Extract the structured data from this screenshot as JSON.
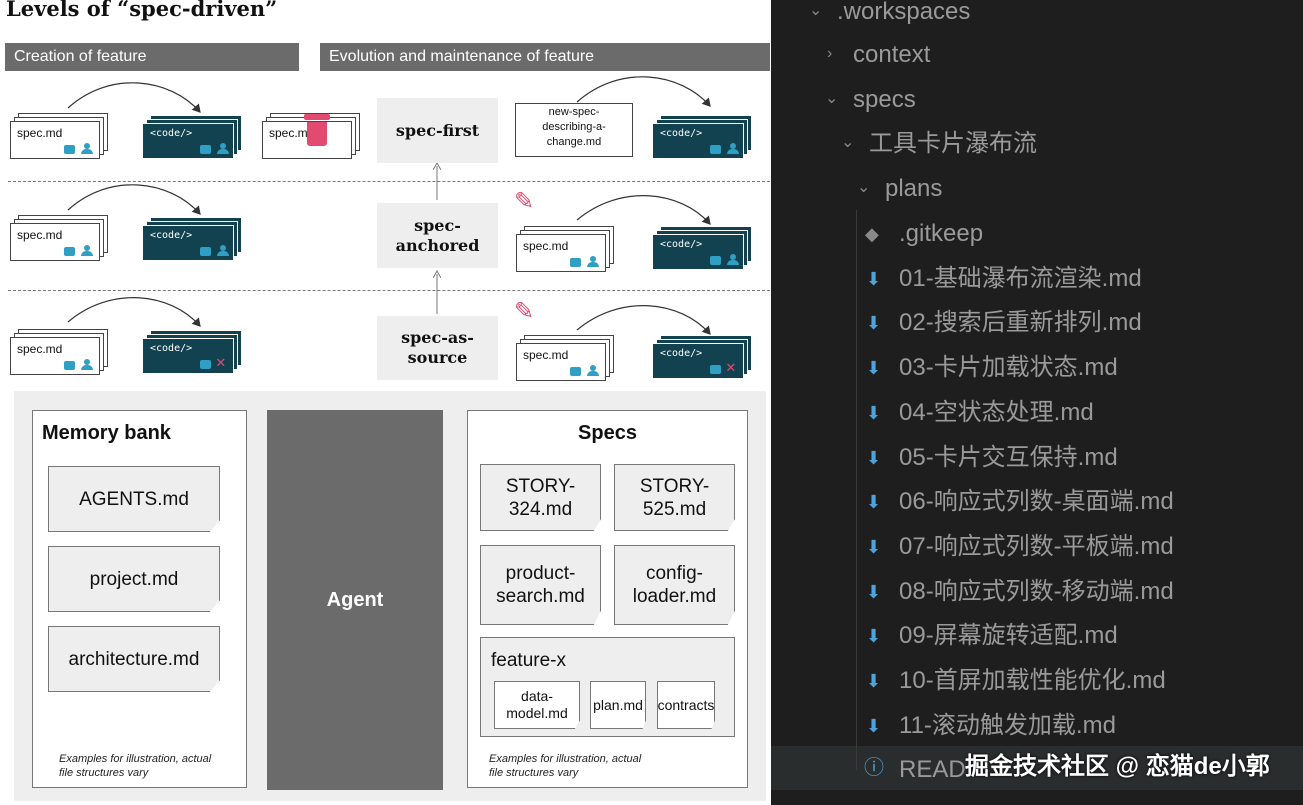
{
  "diagram": {
    "title": "Levels of “spec-driven”",
    "bar_creation": "Creation of feature",
    "bar_evolution": "Evolution and maintenance of feature",
    "levels": [
      "spec-first",
      "spec-anchored",
      "spec-as-source"
    ],
    "spec_file": "spec.md",
    "code_label": "<code/>",
    "new_spec_doc": "new-spec-describing-a-change.md"
  },
  "panel": {
    "memory_bank": {
      "title": "Memory bank",
      "files": [
        "AGENTS.md",
        "project.md",
        "architecture.md"
      ],
      "note": "Examples for illustration, actual file structures vary"
    },
    "agent": "Agent",
    "specs": {
      "title": "Specs",
      "files": [
        "STORY-324.md",
        "STORY-525.md",
        "product-search.md",
        "config-loader.md"
      ],
      "feature": {
        "name": "feature-x",
        "files": [
          "data-model.md",
          "plan.md",
          "contracts"
        ]
      },
      "note": "Examples for illustration, actual file structures vary"
    }
  },
  "explorer": {
    "items": [
      {
        "label": ".workspaces",
        "type": "folder-open"
      },
      {
        "label": "context",
        "type": "folder-closed"
      },
      {
        "label": "specs",
        "type": "folder-open"
      },
      {
        "label": "工具卡片瀑布流",
        "type": "folder-open"
      },
      {
        "label": "plans",
        "type": "folder-open"
      },
      {
        "label": ".gitkeep",
        "type": "git-file"
      },
      {
        "label": "01-基础瀑布流渲染.md",
        "type": "md-file"
      },
      {
        "label": "02-搜索后重新排列.md",
        "type": "md-file"
      },
      {
        "label": "03-卡片加载状态.md",
        "type": "md-file"
      },
      {
        "label": "04-空状态处理.md",
        "type": "md-file"
      },
      {
        "label": "05-卡片交互保持.md",
        "type": "md-file"
      },
      {
        "label": "06-响应式列数-桌面端.md",
        "type": "md-file"
      },
      {
        "label": "07-响应式列数-平板端.md",
        "type": "md-file"
      },
      {
        "label": "08-响应式列数-移动端.md",
        "type": "md-file"
      },
      {
        "label": "09-屏幕旋转适配.md",
        "type": "md-file"
      },
      {
        "label": "10-首屏加载性能优化.md",
        "type": "md-file"
      },
      {
        "label": "11-滚动触发加载.md",
        "type": "md-file"
      },
      {
        "label": "READ",
        "type": "info-file"
      }
    ],
    "watermark": "掘金技术社区 @ 恋猫de小郭"
  },
  "colors": {
    "code_bg": "#12414f",
    "accent_red": "#e34a6f",
    "accent_blue": "#2f9fc4",
    "explorer_bg": "#1e1e1e"
  }
}
